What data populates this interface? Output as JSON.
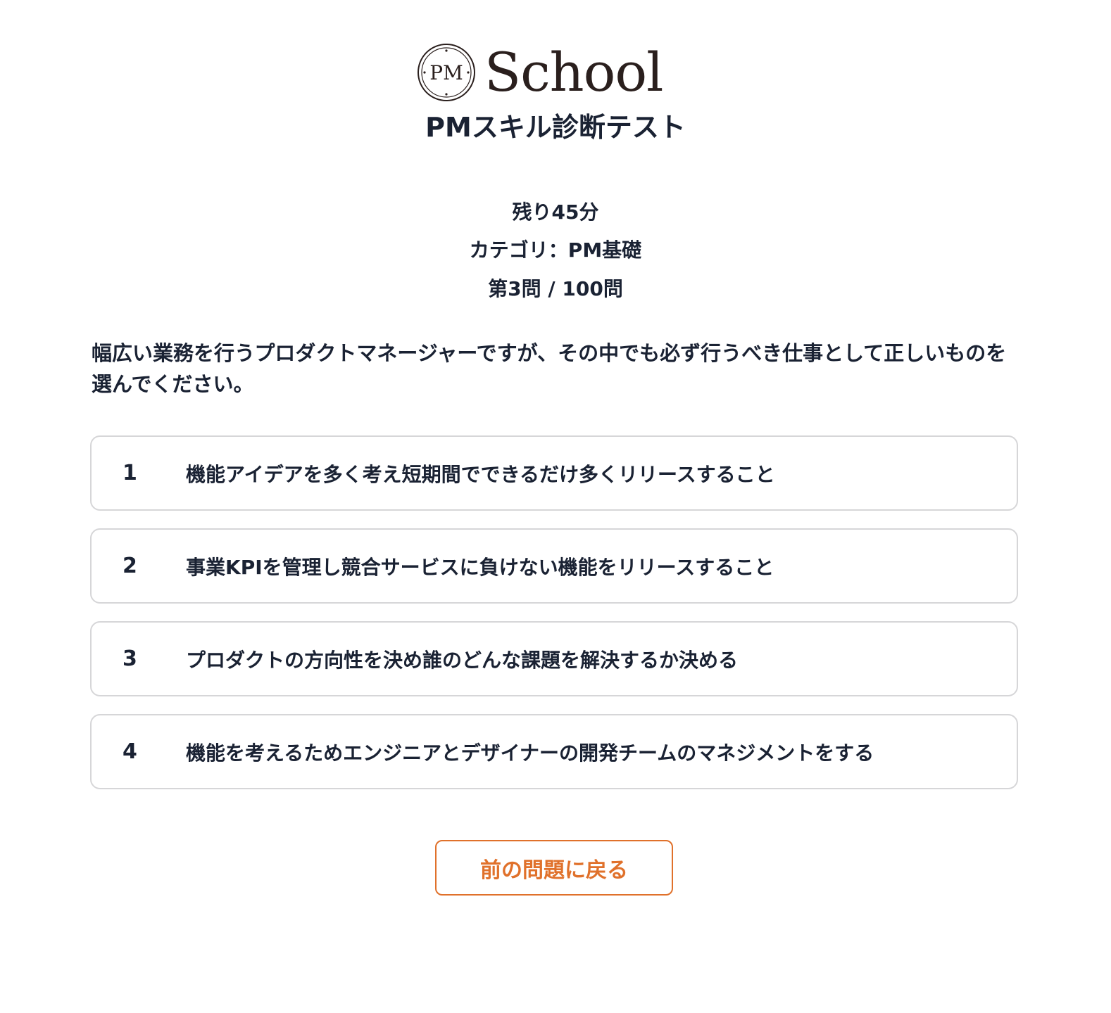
{
  "brand": {
    "mark_text": "PM",
    "wordmark": "School"
  },
  "page": {
    "title": "PMスキル診断テスト"
  },
  "status": {
    "time_remaining": "残り45分",
    "category": "カテゴリ：PM基礎",
    "progress": "第3問 / 100問"
  },
  "question": {
    "text": "幅広い業務を行うプロダクトマネージャーですが、その中でも必ず行うべき仕事として正しいものを選んでください。"
  },
  "options": [
    {
      "number": "1",
      "text": "機能アイデアを多く考え短期間でできるだけ多くリリースすること"
    },
    {
      "number": "2",
      "text": "事業KPIを管理し競合サービスに負けない機能をリリースすること"
    },
    {
      "number": "3",
      "text": "プロダクトの方向性を決め誰のどんな課題を解決するか決める"
    },
    {
      "number": "4",
      "text": "機能を考えるためエンジニアとデザイナーの開発チームのマネジメントをする"
    }
  ],
  "actions": {
    "back_label": "前の問題に戻る"
  },
  "colors": {
    "accent": "#e0712b",
    "text": "#1a2233",
    "border": "#d6d6d8",
    "logo": "#2a1f1d"
  },
  "icons": {
    "logo_mark": "pm-circle-logo-icon"
  }
}
